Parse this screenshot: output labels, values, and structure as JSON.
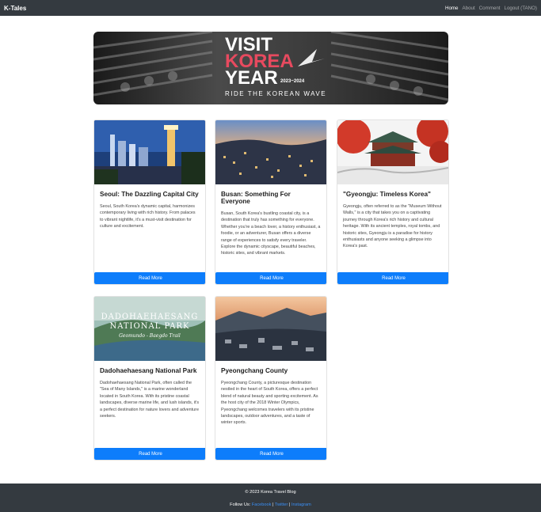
{
  "nav": {
    "brand": "K-Tales",
    "links": [
      "Home",
      "About",
      "Comment",
      "Logout (TANO)"
    ]
  },
  "hero": {
    "line1": "VISIT",
    "line2": "KOREA",
    "line3": "YEAR",
    "years": "2023~2024",
    "tagline": "RIDE THE KOREAN WAVE"
  },
  "cards": [
    {
      "title": "Seoul: The Dazzling Capital City",
      "text": "Seoul, South Korea's dynamic capital, harmonizes contemporary living with rich history. From palaces to vibrant nightlife, it's a must-visit destination for culture and excitement.",
      "button": "Read More"
    },
    {
      "title": "Busan: Something For Everyone",
      "text": "Busan, South Korea's bustling coastal city, is a destination that truly has something for everyone. Whether you're a beach lover, a history enthusiast, a foodie, or an adventurer, Busan offers a diverse range of experiences to satisfy every traveler. Explore the dynamic cityscape, beautiful beaches, historic sites, and vibrant markets.",
      "button": "Read More"
    },
    {
      "title": "\"Gyeongju: Timeless Korea\"",
      "text": "Gyeongju, often referred to as the \"Museum Without Walls,\" is a city that takes you on a captivating journey through Korea's rich history and cultural heritage. With its ancient temples, royal tombs, and historic sites, Gyeongju is a paradise for history enthusiasts and anyone seeking a glimpse into Korea's past.",
      "button": "Read More"
    },
    {
      "title": "Dadohaehaesang National Park",
      "text": "Dadohaehaesang National Park, often called the \"Sea of Many Islands,\" is a marine wonderland located in South Korea. With its pristine coastal landscapes, diverse marine life, and lush islands, it's a perfect destination for nature lovers and adventure seekers.",
      "button": "Read More",
      "img_line1": "DADOHAEHAESANG",
      "img_line2": "NATIONAL PARK",
      "img_line3": "Geomundo - Baegdo Trail"
    },
    {
      "title": "Pyeongchang County",
      "text": "Pyeongchang County, a picturesque destination nestled in the heart of South Korea, offers a perfect blend of natural beauty and sporting excitement. As the host city of the 2018 Winter Olympics, Pyeongchang welcomes travelers with its pristine landscapes, outdoor adventures, and a taste of winter sports.",
      "button": "Read More"
    }
  ],
  "footer": {
    "copyright": "© 2023 Korea Travel Blog",
    "follow": "Follow Us:",
    "links": [
      "Facebook",
      "Twitter",
      "Instagram"
    ],
    "sep": "|"
  }
}
